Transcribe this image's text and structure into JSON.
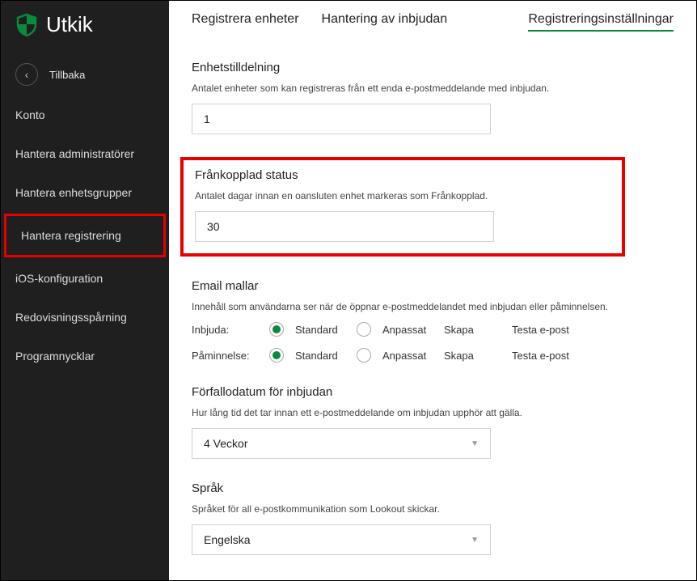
{
  "brand": {
    "name": "Utkik"
  },
  "sidebar": {
    "back_label": "Tillbaka",
    "items": [
      "Konto",
      "Hantera administratörer",
      "Hantera enhetsgrupper",
      "Hantera registrering",
      "iOS-konfiguration",
      "Redovisningsspårning",
      "Programnycklar"
    ],
    "selected_index": 3
  },
  "tabs": {
    "register": "Registrera enheter",
    "invitation": "Hantering av inbjudan",
    "settings": "Registreringsinställningar",
    "active": "settings"
  },
  "device_allocation": {
    "title": "Enhetstilldelning",
    "desc": "Antalet enheter som kan registreras från ett enda e-postmeddelande med inbjudan.",
    "value": "1"
  },
  "disconnected": {
    "title": "Frånkopplad status",
    "desc": "Antalet dagar innan en oansluten enhet markeras som Frånkopplad.",
    "value": "30"
  },
  "email_templates": {
    "title": "Email mallar",
    "desc": "Innehåll som användarna ser när de öppnar e-postmeddelandet med inbjudan eller påminnelsen.",
    "invite_label": "Inbjuda:",
    "reminder_label": "Påminnelse:",
    "standard": "Standard",
    "custom": "Anpassat",
    "create": "Skapa",
    "test": "Testa e-post"
  },
  "expiration": {
    "title": "Förfallodatum för inbjudan",
    "desc": "Hur lång tid det tar innan ett e-postmeddelande om inbjudan upphör att gälla.",
    "value": "4 Veckor"
  },
  "language": {
    "title": "Språk",
    "desc": "Språket för all e-postkommunikation som Lookout skickar.",
    "value": "Engelska"
  }
}
